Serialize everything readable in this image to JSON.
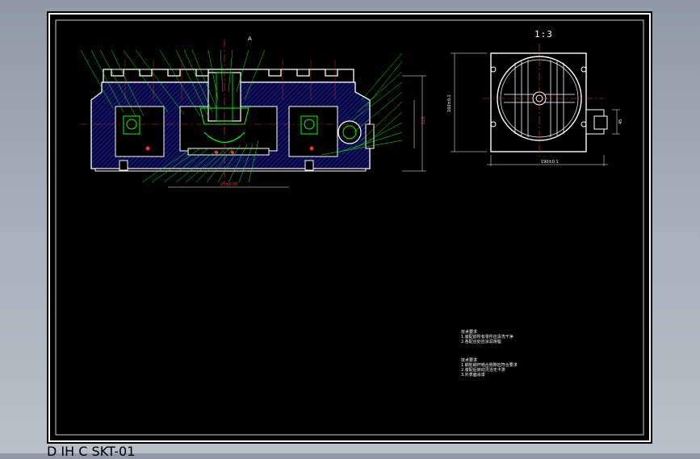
{
  "drawing": {
    "scale_label": "1:3",
    "section_a_label": "A",
    "view_c_label": "C",
    "view_d_label": "D"
  },
  "colors": {
    "background": "#000000",
    "outline": "#ffffff",
    "hatch": "#2a2aa8",
    "leader": "#00ff00",
    "centerline": "#ff3030",
    "dimension": "#ff3030",
    "accent": "#ff00ff",
    "cyan": "#00ffff"
  },
  "notes": {
    "title_1": "技术要求",
    "lines_1": [
      "1.装配前所有零件应清洗干净",
      "2.各配合处应涂润滑脂"
    ],
    "title_2": "技术要求",
    "lines_2": [
      "1.蜗轮蜗杆啮合侧隙应符合要求",
      "2.装配后转动灵活无卡滞",
      "3.外表面涂漆"
    ]
  },
  "title_block": {
    "drawing_no": "SKT-01"
  }
}
